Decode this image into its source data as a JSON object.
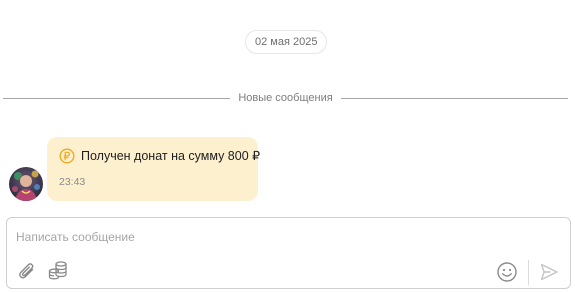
{
  "date_separator": "02 мая 2025",
  "new_messages_divider": "Новые сообщения",
  "message": {
    "icon": "coin-ruble-icon",
    "text": "Получен донат на сумму 800 ₽",
    "time": "23:43",
    "bubble_color": "#fdf0cf",
    "accent_color": "#f2a81d"
  },
  "composer": {
    "placeholder": "Написать сообщение",
    "value": "",
    "icons": [
      "paperclip-icon",
      "coins-icon",
      "smiley-icon",
      "send-icon"
    ]
  }
}
